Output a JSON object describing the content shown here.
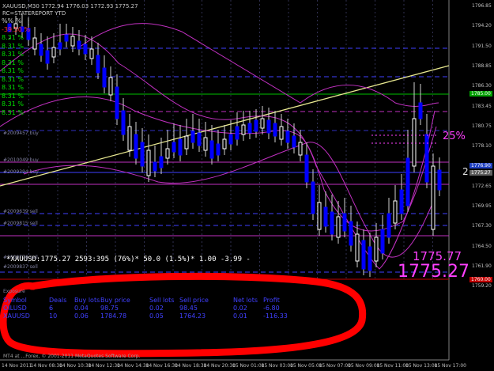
{
  "header": {
    "symbol_line": "XAUUSD,M30  1772.94 1776.03 1772.93 1775.27",
    "report_title": "RC=STATEREPORT YTD"
  },
  "percent_panel": [
    "%% %",
    "-39.50 %",
    "8.31 %",
    "8.31 %",
    "8.31 %",
    "8.31 %",
    "8.31 %",
    "8.31 %",
    "8.31 %",
    "8.31 %",
    "8.31 %",
    "8.31 %"
  ],
  "order_labels": [
    "#2009457 buy",
    "#2010049 buy",
    "#2009394 buy",
    "#2009639 sell",
    "#2009815 sell",
    "#2009776 sell",
    "#2009837 sell"
  ],
  "ticker_line": "*XAUUSD:1775.27 2593:395  (76%)* 50.0  (1.5%)*  1.00  -3.99  -",
  "big_price_1": "1775.77",
  "big_price_2": "1775.27",
  "annotation_pct": "25%",
  "annotation_num": "2",
  "price_tags": [
    {
      "label": "1785.00",
      "color": "#00a000"
    },
    {
      "label": "1776.90",
      "color": "#2040c0"
    },
    {
      "label": "1775.27",
      "color": "#606060"
    },
    {
      "label": "1760.00",
      "color": "#c00000"
    }
  ],
  "y_axis": [
    "1796.85",
    "1794.20",
    "1791.50",
    "1788.85",
    "1786.30",
    "1783.45",
    "1780.75",
    "1778.10",
    "1775.40",
    "1772.65",
    "1769.95",
    "1767.30",
    "1764.50",
    "1761.90",
    "1759.20"
  ],
  "x_axis": [
    "14 Nov 2011",
    "14 Nov 08:30",
    "14 Nov 10:30",
    "14 Nov 12:30",
    "14 Nov 14:30",
    "14 Nov 16:30",
    "14 Nov 18:30",
    "14 Nov 20:30",
    "15 Nov 01:00",
    "15 Nov 03:00",
    "15 Nov 05:00",
    "15 Nov 07:00",
    "15 Nov 09:00",
    "15 Nov 11:00",
    "15 Nov 13:00",
    "15 Nov 17:00"
  ],
  "positions": {
    "title": "Exposure",
    "headers": [
      "Symbol",
      "Deals",
      "Buy lots",
      "Buy price",
      "Sell lots",
      "Sell price",
      "Net lots",
      "Profit"
    ],
    "rows": [
      [
        "OILUSD",
        "6",
        "0.04",
        "98.75",
        "0.02",
        "98.45",
        "0.02",
        "-6.80"
      ],
      [
        "XAUUSD",
        "10",
        "0.06",
        "1784.78",
        "0.05",
        "1764.23",
        "0.01",
        "-116.33"
      ]
    ]
  },
  "copyright": "MT4 at ...Forex, © 2001-2011 MetaQuotes Software Corp.",
  "colors": {
    "background": "#000000",
    "bull_candle": "#0000ff",
    "bear_candle": "#ffffff",
    "bands": "#c030c0",
    "trendline": "#e8e890",
    "annotation_circle": "#ff0000"
  }
}
